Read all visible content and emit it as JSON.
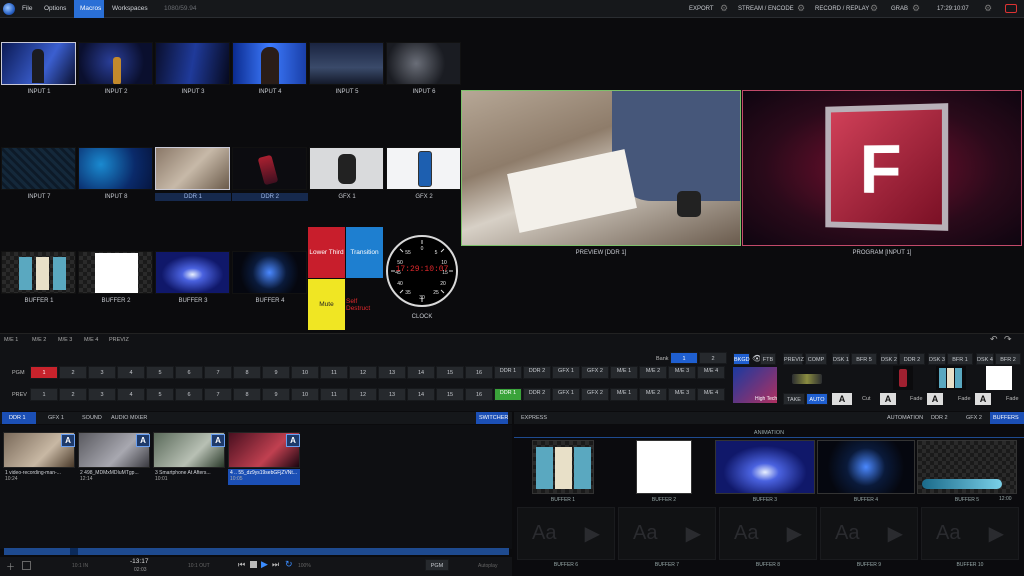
{
  "menu": {
    "file": "File",
    "options": "Options",
    "macros": "Macros",
    "workspaces": "Workspaces",
    "resolution": "1080/59.94"
  },
  "topright": {
    "export": "EXPORT",
    "stream": "STREAM / ENCODE",
    "record": "RECORD / REPLAY",
    "grab": "GRAB",
    "time": "17:29:10:07"
  },
  "sources": {
    "row1": [
      "INPUT 1",
      "INPUT 2",
      "INPUT 3",
      "INPUT 4",
      "INPUT 5",
      "INPUT 6"
    ],
    "row2": [
      "INPUT 7",
      "INPUT 8",
      "DDR 1",
      "DDR 2",
      "GFX 1",
      "GFX 2"
    ],
    "row3": [
      "BUFFER 1",
      "BUFFER 2",
      "BUFFER 3",
      "BUFFER 4"
    ]
  },
  "macros": {
    "lower_third": "Lower Third",
    "transition": "Transition",
    "mute": "Mute",
    "self_destruct": "Self Destruct",
    "clock_label": "CLOCK",
    "clock_time": "17:29:10:07"
  },
  "monitors": {
    "preview": "PREVIEW [DDR 1]",
    "program": "PROGRAM [INPUT 1]"
  },
  "me_tabs": [
    "M/E 1",
    "M/E 2",
    "M/E 3",
    "M/E 4",
    "PREVIZ"
  ],
  "bank": {
    "label": "Bank",
    "b1": "1",
    "b2": "2"
  },
  "pgm_row": {
    "label": "PGM",
    "buttons": [
      "1",
      "2",
      "3",
      "4",
      "5",
      "6",
      "7",
      "8",
      "9",
      "10",
      "11",
      "12",
      "13",
      "14",
      "15",
      "16",
      "DDR 1",
      "DDR 2",
      "GFX 1",
      "GFX 2",
      "M/E 1",
      "M/E 2",
      "M/E 3",
      "M/E 4"
    ]
  },
  "prev_row": {
    "label": "PREV",
    "buttons": [
      "1",
      "2",
      "3",
      "4",
      "5",
      "6",
      "7",
      "8",
      "9",
      "10",
      "11",
      "12",
      "13",
      "14",
      "15",
      "16",
      "DDR 1",
      "DDR 2",
      "GFX 1",
      "GFX 2",
      "M/E 1",
      "M/E 2",
      "M/E 3",
      "M/E 4"
    ]
  },
  "transition": {
    "bkgd": "BKGD",
    "ftb": "FTB",
    "previz": "PREVIZ",
    "comp": "COMP",
    "take": "TAKE",
    "auto": "AUTO",
    "cut": "Cut",
    "fade": "Fade",
    "high_tech": "High Tech"
  },
  "dsk": [
    {
      "a": "DSK 1",
      "b": "BFR 5"
    },
    {
      "a": "DSK 2",
      "b": "DDR 2"
    },
    {
      "a": "DSK 3",
      "b": "BFR 1"
    },
    {
      "a": "DSK 4",
      "b": "BFR 2"
    }
  ],
  "bottom_tabs": {
    "ddr1": "DDR 1",
    "gfx1": "GFX 1",
    "sound": "SOUND",
    "audio_mixer": "AUDIO MIXER",
    "switcher": "SWITCHER"
  },
  "ddr_clips": [
    {
      "name": "1 video-recording-man-...",
      "dur": "10:24"
    },
    {
      "name": "2 498_MDMxMDIuMTgp...",
      "dur": "12:14"
    },
    {
      "name": "3 Smartphone At Afters...",
      "dur": "10:01"
    },
    {
      "name": "4 .. 55_dz9ys19sebGFjZVNt...",
      "dur": "10:05"
    }
  ],
  "ddr_transport": {
    "remaining": "-13:17",
    "elapsed": "02:03",
    "in": "10:1 IN",
    "out": "10:1 OUT",
    "speed": "100%",
    "pgm": "PGM",
    "autoplay": "Autoplay"
  },
  "right_tabs": {
    "express": "EXPRESS",
    "automation": "AUTOMATION",
    "ddr2": "DDR 2",
    "gfx2": "GFX 2",
    "buffers": "BUFFERS",
    "animation": "ANIMATION"
  },
  "buffers_top": [
    "BUFFER 1",
    "BUFFER 2",
    "BUFFER 3",
    "BUFFER 4",
    "BUFFER 5"
  ],
  "buffers_bottom": [
    "BUFFER 6",
    "BUFFER 7",
    "BUFFER 8",
    "BUFFER 9",
    "BUFFER 10"
  ],
  "buffer5_time": "12:00",
  "buffer5_time2": "12:00"
}
